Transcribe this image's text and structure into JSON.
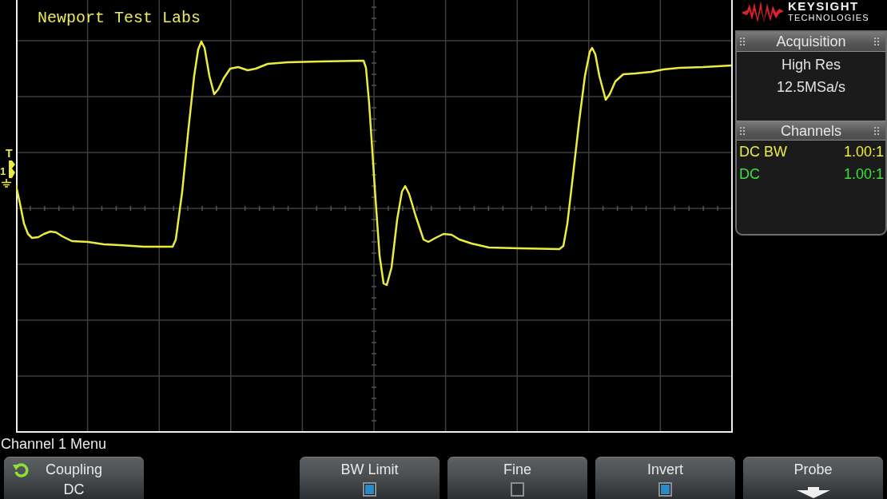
{
  "display": {
    "annotation": "Newport Test Labs",
    "trigger_marker": "T",
    "channel_marker": "1"
  },
  "brand": {
    "name": "KEYSIGHT",
    "tagline": "TECHNOLOGIES"
  },
  "acquisition": {
    "title": "Acquisition",
    "mode": "High Res",
    "sample_rate": "12.5MSa/s"
  },
  "channels": {
    "title": "Channels",
    "rows": [
      {
        "coupling": "DC BW",
        "probe": "1.00:1",
        "color": "#ecec3c"
      },
      {
        "coupling": "DC",
        "probe": "1.00:1",
        "color": "#3ee03e"
      }
    ]
  },
  "menu": {
    "title": "Channel 1 Menu",
    "softkeys": [
      {
        "kind": "select",
        "label": "Coupling",
        "value": "DC"
      },
      {
        "kind": "checkbox",
        "label": "BW Limit",
        "checked": true
      },
      {
        "kind": "checkbox",
        "label": "Fine",
        "checked": false
      },
      {
        "kind": "checkbox",
        "label": "Invert",
        "checked": true
      },
      {
        "kind": "submenu",
        "label": "Probe"
      }
    ]
  }
}
